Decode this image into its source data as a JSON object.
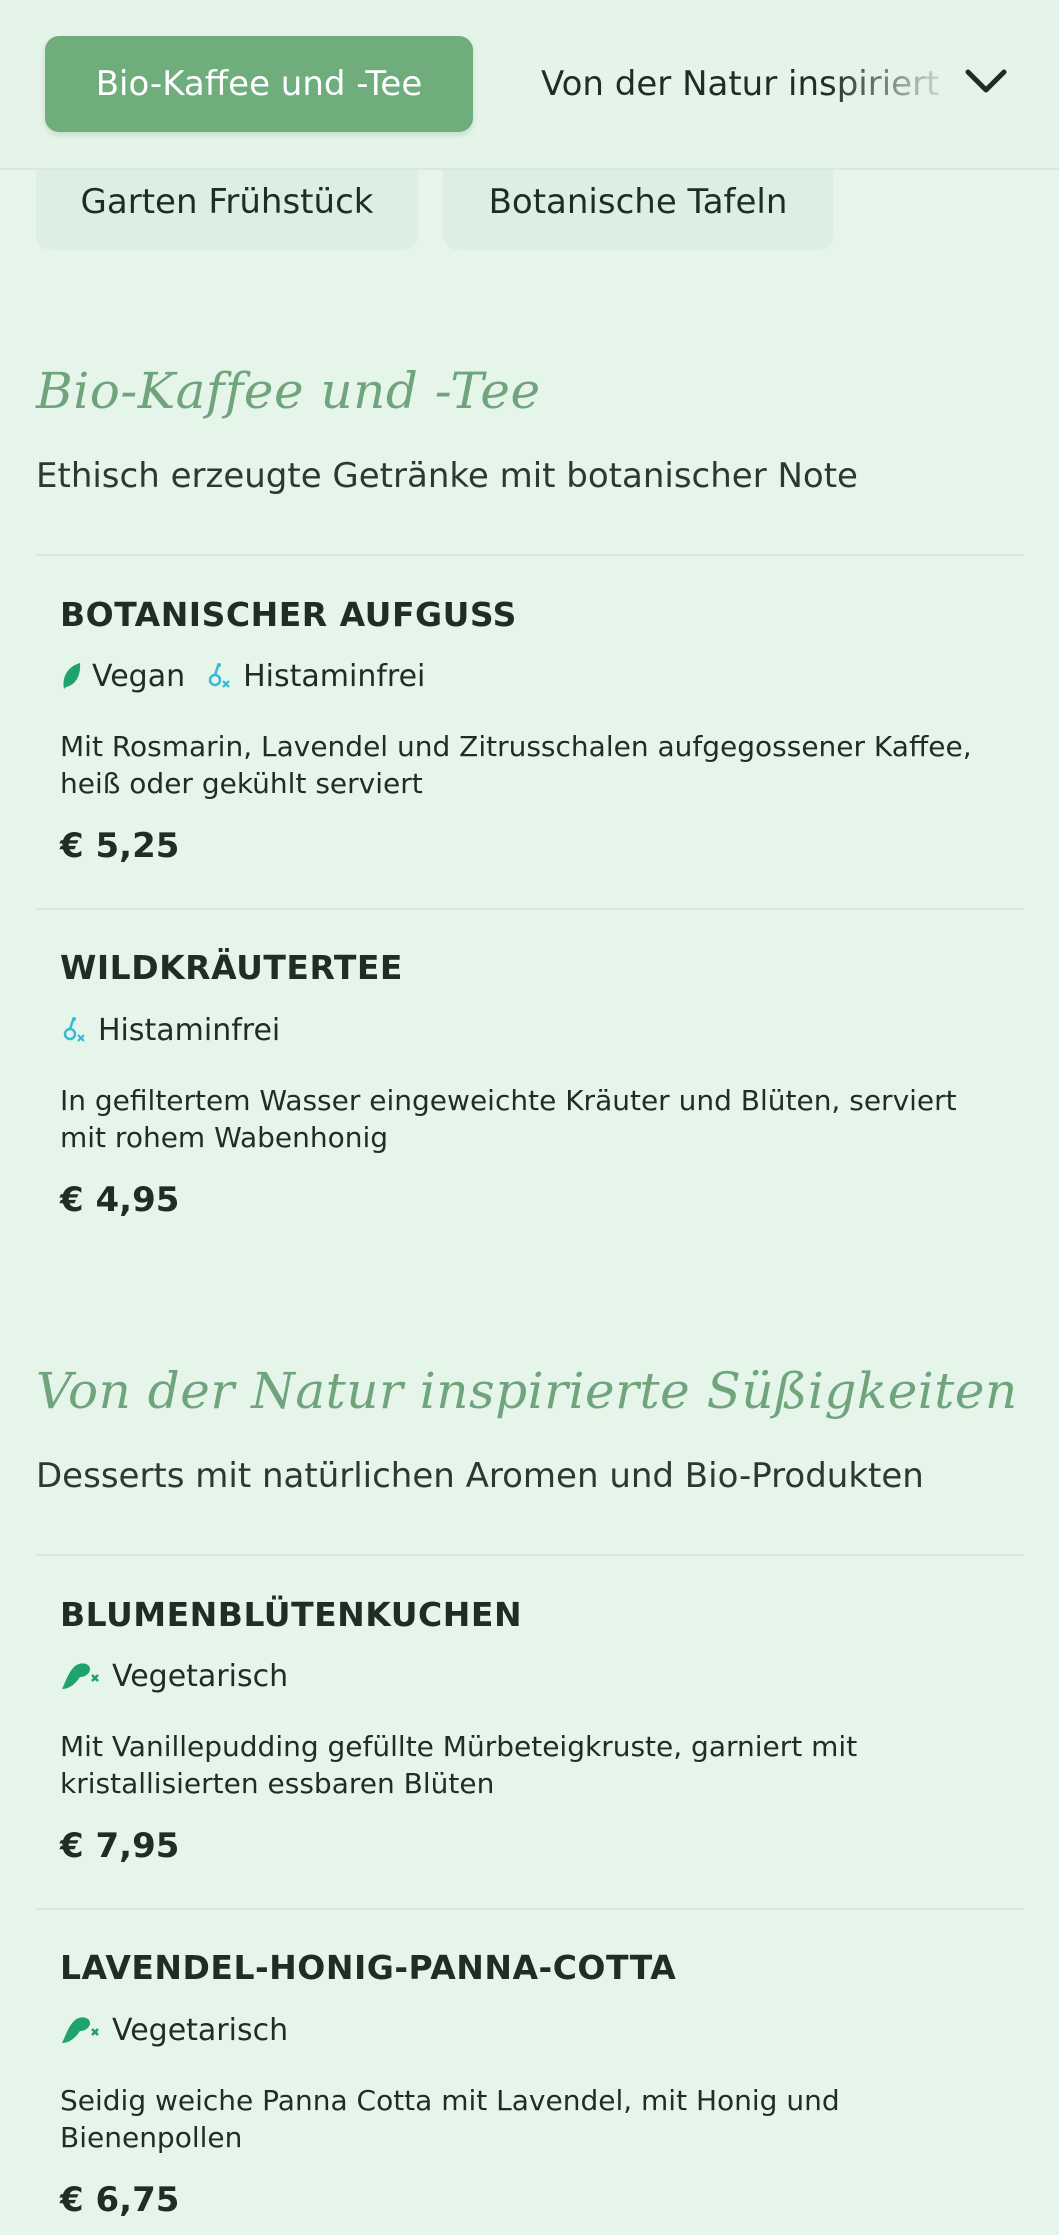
{
  "tabs": {
    "active": "Bio-Kaffee und -Tee",
    "next": "Von der Natur inspiriert",
    "pills": [
      "Garten Frühstück",
      "Botanische Tafeln"
    ]
  },
  "sections": [
    {
      "title": "Bio-Kaffee und -Tee",
      "subtitle": "Ethisch erzeugte Getränke mit botanischer Note",
      "items": [
        {
          "name": "BOTANISCHER AUFGUSS",
          "tags": [
            "Vegan",
            "Histaminfrei"
          ],
          "description_lines": [
            "Mit Rosmarin, Lavendel und Zitrusschalen aufgegossener Kaffee,",
            "heiß oder gekühlt serviert"
          ],
          "price": "€ 5,25"
        },
        {
          "name": "WILDKRÄUTERTEE",
          "tags": [
            "Histaminfrei"
          ],
          "description_lines": [
            "In gefiltertem Wasser eingeweichte Kräuter und Blüten, serviert",
            "mit rohem Wabenhonig"
          ],
          "price": "€ 4,95"
        }
      ]
    },
    {
      "title": "Von der Natur inspirierte Süßigkeiten",
      "subtitle": "Desserts mit natürlichen Aromen und Bio-Produkten",
      "items": [
        {
          "name": "BLUMENBLÜTENKUCHEN",
          "tags": [
            "Vegetarisch"
          ],
          "description_lines": [
            "Mit Vanillepudding gefüllte Mürbeteigkruste, garniert mit",
            "kristallisierten essbaren Blüten"
          ],
          "price": "€ 7,95"
        },
        {
          "name": "LAVENDEL-HONIG-PANNA-COTTA",
          "tags": [
            "Vegetarisch"
          ],
          "description_lines": [
            "Seidig weiche Panna Cotta mit Lavendel, mit Honig und",
            "Bienenpollen"
          ],
          "price": "€ 6,75"
        }
      ]
    }
  ],
  "colors": {
    "background": "#e6f5ea",
    "accent": "#6fae7c",
    "title_green": "#6fa47c",
    "vegan_icon": "#1fa36a",
    "histamine_icon": "#35b9d6"
  },
  "icons": [
    "chevron-down-icon",
    "leaf-icon",
    "histamine-free-icon",
    "vegetarian-icon"
  ]
}
